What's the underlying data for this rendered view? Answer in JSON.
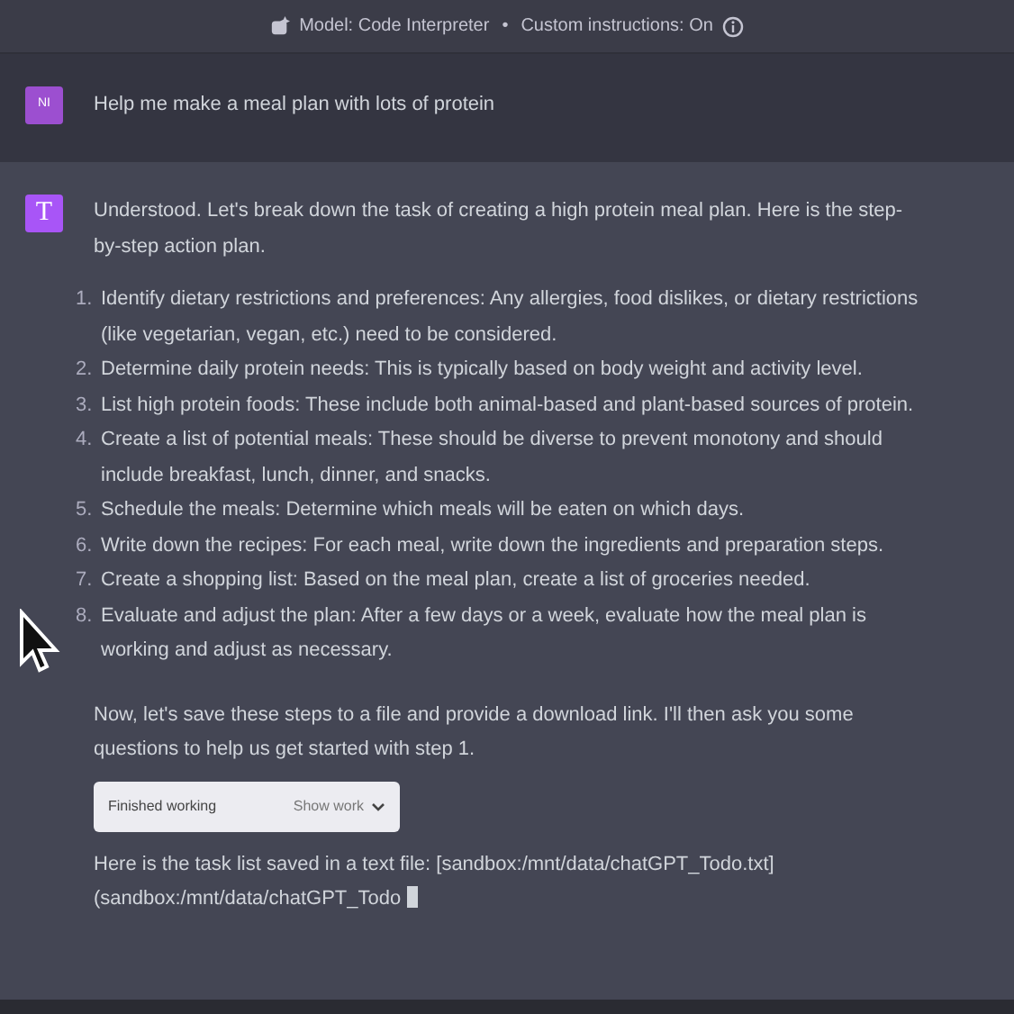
{
  "header": {
    "model": "Model: Code Interpreter",
    "separator": "•",
    "instructions": "Custom instructions: On"
  },
  "user_message": {
    "avatar": "NI",
    "text": "Help me make a meal plan with lots of protein"
  },
  "assistant_message": {
    "avatar": "T",
    "intro": "Understood. Let's break down the task of creating a high protein meal plan. Here is the step-by-step action plan.",
    "steps": [
      {
        "number": "1.",
        "text": "Identify dietary restrictions and preferences: Any allergies, food dislikes, or dietary restrictions (like vegetarian, vegan, etc.) need to be considered."
      },
      {
        "number": "2.",
        "text": "Determine daily protein needs: This is typically based on body weight and activity level."
      },
      {
        "number": "3.",
        "text": "List high protein foods: These include both animal-based and plant-based sources of protein."
      },
      {
        "number": "4.",
        "text": "Create a list of potential meals: These should be diverse to prevent monotony and should include breakfast, lunch, dinner, and snacks."
      },
      {
        "number": "5.",
        "text": "Schedule the meals: Determine which meals will be eaten on which days."
      },
      {
        "number": "6.",
        "text": "Write down the recipes: For each meal, write down the ingredients and preparation steps."
      },
      {
        "number": "7.",
        "text": "Create a shopping list: Based on the meal plan, create a list of groceries needed."
      },
      {
        "number": "8.",
        "text": "Evaluate and adjust the plan: After a few days or a week, evaluate how the meal plan is working and adjust as necessary."
      }
    ],
    "followup": "Now, let's save these steps to a file and provide a download link. I'll then ask you some questions to help us get started with step 1.",
    "work_panel": {
      "status": "Finished working",
      "toggle": "Show work",
      "expanded": false
    },
    "result": "Here is the task list saved in a text file: [sandbox:/mnt/data/chatGPT_Todo.txt](sandbox:/mnt/data/chatGPT_Todo",
    "streaming": true
  }
}
